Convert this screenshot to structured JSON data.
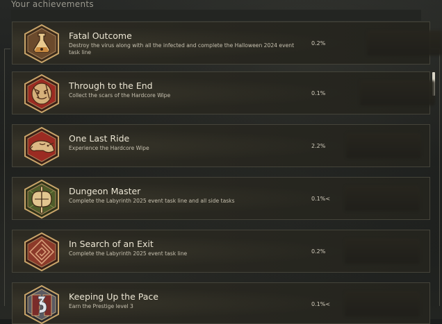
{
  "header": {
    "title": "Your achievements"
  },
  "achievements": [
    {
      "title": "Fatal Outcome",
      "description": "Destroy the virus along with all the infected and complete the Halloween 2024 event task line",
      "percent": "0.2%",
      "icon": "flask-icon"
    },
    {
      "title": "Through to the End",
      "description": "Collect the scars of the Hardcore Wipe",
      "percent": "0.1%",
      "icon": "scarred-face-icon"
    },
    {
      "title": "One Last Ride",
      "description": "Experience the Hardcore Wipe",
      "percent": "2.2%",
      "icon": "boar-icon"
    },
    {
      "title": "Dungeon Master",
      "description": "Complete the Labyrinth 2025 event task line and all side tasks",
      "percent": "0.1%<",
      "icon": "axe-icon"
    },
    {
      "title": "In Search of an Exit",
      "description": "Complete the Labyrinth 2025 event task line",
      "percent": "0.2%",
      "icon": "maze-icon"
    },
    {
      "title": "Keeping Up the Pace",
      "description": "Earn the Prestige level 3",
      "percent": "0.1%<",
      "icon": "prestige-3-icon"
    }
  ],
  "colors": {
    "gold": "#c9a56a",
    "brown": "#6b4a2c",
    "red": "#9b2b22",
    "green": "#4f5c2a"
  }
}
